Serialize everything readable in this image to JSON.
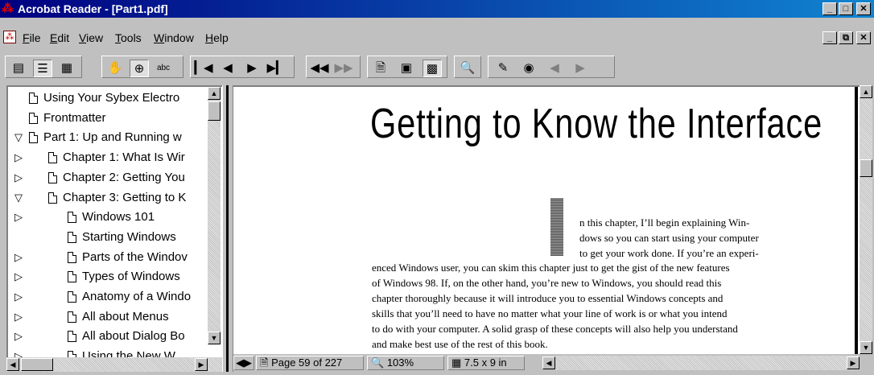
{
  "window": {
    "title": "Acrobat Reader - [Part1.pdf]",
    "controls": [
      "minimize-icon",
      "maximize-icon",
      "close-icon"
    ],
    "doc_controls": [
      "minimize-icon",
      "restore-icon",
      "close-icon"
    ]
  },
  "menu": {
    "items": [
      {
        "label": "File",
        "mnemonic": "F"
      },
      {
        "label": "Edit",
        "mnemonic": "E"
      },
      {
        "label": "View",
        "mnemonic": "V"
      },
      {
        "label": "Tools",
        "mnemonic": "T"
      },
      {
        "label": "Window",
        "mnemonic": "W"
      },
      {
        "label": "Help",
        "mnemonic": "H"
      }
    ]
  },
  "toolbar": {
    "icons": [
      "page-only-icon",
      "bookmarks-page-icon",
      "thumbnails-page-icon",
      "hand-tool-icon",
      "zoom-tool-icon",
      "text-select-icon",
      "first-page-icon",
      "previous-page-icon",
      "next-page-icon",
      "last-page-icon",
      "go-back-icon",
      "go-forward-icon",
      "actual-size-icon",
      "fit-page-icon",
      "fit-width-icon",
      "find-icon",
      "search-icon",
      "search-results-icon",
      "search-previous-icon",
      "search-next-icon"
    ]
  },
  "bookmarks": {
    "items": [
      {
        "label": "Using Your Sybex Electro",
        "indent": 0,
        "arrow": ""
      },
      {
        "label": "Frontmatter",
        "indent": 0,
        "arrow": ""
      },
      {
        "label": "Part 1: Up and Running w",
        "indent": 0,
        "arrow": "expanded"
      },
      {
        "label": "Chapter 1: What Is Wir",
        "indent": 1,
        "arrow": "collapsed"
      },
      {
        "label": "Chapter 2: Getting You",
        "indent": 1,
        "arrow": "collapsed"
      },
      {
        "label": "Chapter 3: Getting to K",
        "indent": 1,
        "arrow": "expanded"
      },
      {
        "label": "Windows 101",
        "indent": 2,
        "arrow": "collapsed"
      },
      {
        "label": "Starting Windows",
        "indent": 2,
        "arrow": ""
      },
      {
        "label": "Parts of the Windov",
        "indent": 2,
        "arrow": "collapsed"
      },
      {
        "label": "Types of Windows",
        "indent": 2,
        "arrow": "collapsed"
      },
      {
        "label": "Anatomy of a Windo",
        "indent": 2,
        "arrow": "collapsed"
      },
      {
        "label": "All about Menus",
        "indent": 2,
        "arrow": "collapsed"
      },
      {
        "label": "All about Dialog Bo",
        "indent": 2,
        "arrow": "collapsed"
      },
      {
        "label": "Using the New W",
        "indent": 2,
        "arrow": "collapsed"
      }
    ]
  },
  "document": {
    "heading": "Getting to Know the Interface",
    "lines": [
      "n this chapter, I’ll begin explaining Win-",
      "dows so you can start using your computer",
      "to get your work done. If you’re an experi-",
      "enced Windows user, you can skim this chapter just to get the gist of the new features",
      "of Windows 98. If, on the other hand, you’re new to Windows, you should read this",
      "chapter thoroughly because it will introduce you to essential Windows concepts and",
      "skills that you’ll need to have no matter what your line of work is or what you intend",
      "to do with your computer. A solid grasp of these concepts will also help you understand",
      "and make best use of the rest of this book."
    ]
  },
  "status": {
    "page": "Page 59 of 227",
    "zoom": "103%",
    "size": "7.5 x 9 in"
  }
}
